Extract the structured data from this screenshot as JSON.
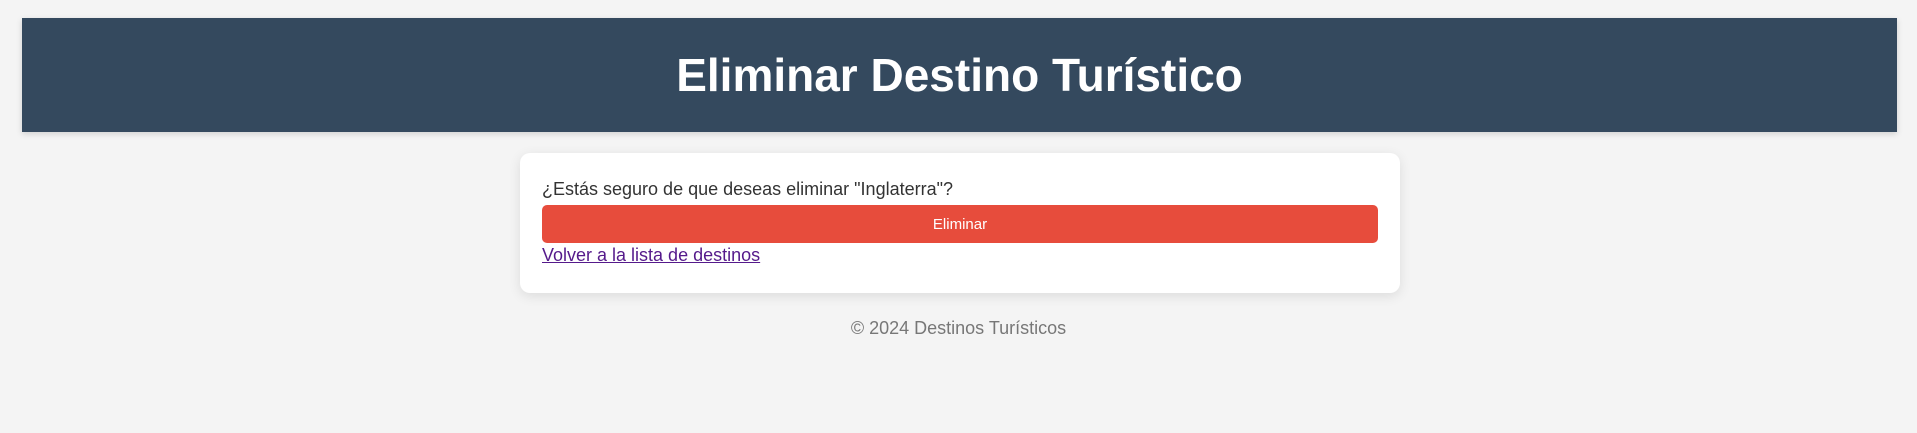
{
  "header": {
    "title": "Eliminar Destino Turístico"
  },
  "confirm": {
    "question": "¿Estás seguro de que deseas eliminar \"Inglaterra\"?",
    "delete_label": "Eliminar",
    "back_label": "Volver a la lista de destinos"
  },
  "footer": {
    "text": "© 2024 Destinos Turísticos"
  },
  "colors": {
    "header_bg": "#34495e",
    "delete_button": "#e74c3c",
    "page_bg": "#f4f4f4",
    "link_visited": "#551a8b"
  }
}
